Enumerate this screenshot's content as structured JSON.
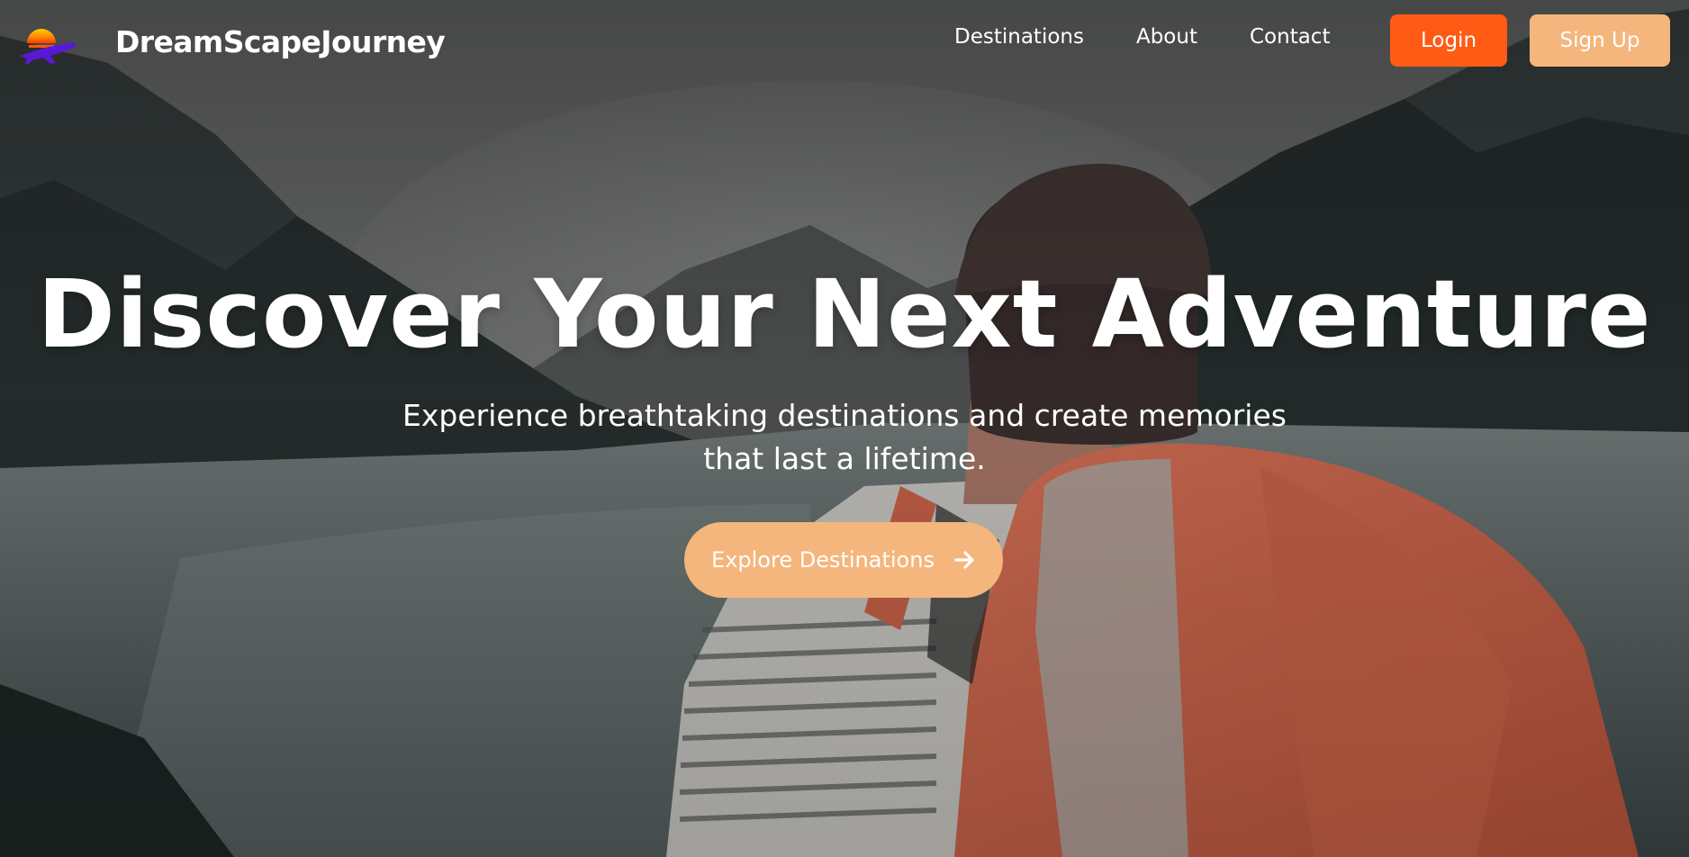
{
  "brand": {
    "name": "DreamScapeJourney",
    "logo_icon": "sunset-airplane-icon"
  },
  "nav": {
    "links": [
      "Destinations",
      "About",
      "Contact"
    ],
    "login_label": "Login",
    "signup_label": "Sign Up"
  },
  "hero": {
    "title": "Discover Your Next Adventure",
    "subtitle": "Experience breathtaking destinations and create memories that last a lifetime.",
    "cta_label": "Explore Destinations",
    "cta_icon": "arrow-right-icon",
    "background_image": "hiker-with-orange-backpack-at-mountain-lake"
  },
  "colors": {
    "login_button": "#ff5b14",
    "signup_button": "#f4b67c",
    "cta_button": "#f4b67c",
    "text": "#ffffff"
  }
}
